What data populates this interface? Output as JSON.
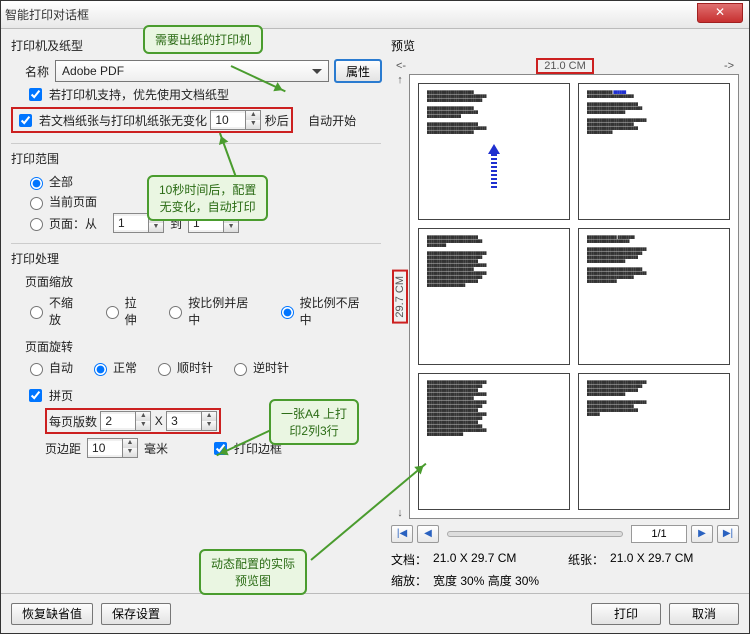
{
  "window": {
    "title": "智能打印对话框"
  },
  "callouts": {
    "printer_needed": "需要出纸的打印机",
    "timer_hint_l1": "10秒时间后，配置",
    "timer_hint_l2": "无变化，自动打印",
    "a4_hint_l1": "一张A4 上打",
    "a4_hint_l2": "印2列3行",
    "preview_hint_l1": "动态配置的实际",
    "preview_hint_l2": "预览图"
  },
  "printer": {
    "section": "打印机及纸型",
    "name_label": "名称",
    "name_value": "Adobe PDF",
    "props_btn": "属性",
    "chk_doc_paper": "若打印机支持，优先使用文档纸型",
    "chk_auto_start": "若文档纸张与打印机纸张无变化",
    "timer_value": "10",
    "timer_unit": "秒后",
    "auto_label": "自动开始"
  },
  "range": {
    "section": "打印范围",
    "all": "全部",
    "current": "当前页面",
    "pages": "页面：从",
    "from": "1",
    "to_label": "到",
    "to": "1"
  },
  "process": {
    "section": "打印处理",
    "scale_label": "页面缩放",
    "scale_none": "不缩放",
    "scale_stretch": "拉伸",
    "scale_fit_center": "按比例并居中",
    "scale_fit_nocenter": "按比例不居中",
    "rotate_label": "页面旋转",
    "rotate_auto": "自动",
    "rotate_normal": "正常",
    "rotate_cw": "顺时针",
    "rotate_ccw": "逆时针",
    "tile_chk": "拼页",
    "per_page_label": "每页版数",
    "cols": "2",
    "x": "X",
    "rows": "3",
    "margin_label": "页边距",
    "margin_val": "10",
    "margin_unit": "毫米",
    "border_chk": "打印边框"
  },
  "preview": {
    "title": "预览",
    "width": "21.0 CM",
    "height": "29.7 CM",
    "page_indicator": "1/1",
    "doc_label": "文档：",
    "doc_size": "21.0 X 29.7 CM",
    "paper_label": "纸张：",
    "paper_size": "21.0 X 29.7 CM",
    "zoom_label": "缩放：",
    "zoom_value": "宽度 30%  高度 30%"
  },
  "footer": {
    "restore": "恢复缺省值",
    "save": "保存设置",
    "print": "打印",
    "cancel": "取消"
  }
}
